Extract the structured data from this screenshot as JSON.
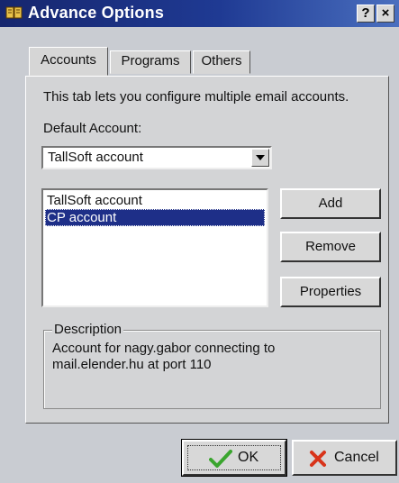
{
  "window": {
    "title": "Advance Options",
    "help_label": "?",
    "close_label": "×"
  },
  "tabs": [
    {
      "label": "Accounts",
      "active": true
    },
    {
      "label": "Programs",
      "active": false
    },
    {
      "label": "Others",
      "active": false
    }
  ],
  "accounts": {
    "intro": "This tab lets you configure multiple email accounts.",
    "default_label": "Default Account:",
    "default_value": "TallSoft account",
    "list": [
      {
        "label": "TallSoft account",
        "selected": false
      },
      {
        "label": "CP account",
        "selected": true
      }
    ],
    "buttons": {
      "add": "Add",
      "remove": "Remove",
      "properties": "Properties"
    },
    "description_label": "Description",
    "description_line1": "Account for nagy.gabor connecting to",
    "description_line2": "mail.elender.hu at port 110"
  },
  "footer": {
    "ok_label": "OK",
    "cancel_label": "Cancel"
  },
  "colors": {
    "titlebar": "#1f3a93",
    "selection": "#1e2f88",
    "ok_check": "#3aa52e",
    "cancel_x": "#d8341a"
  },
  "icons": {
    "title": "app-icon",
    "ok": "checkmark-icon",
    "cancel": "red-x-icon",
    "dropdown": "chevron-down-icon"
  }
}
